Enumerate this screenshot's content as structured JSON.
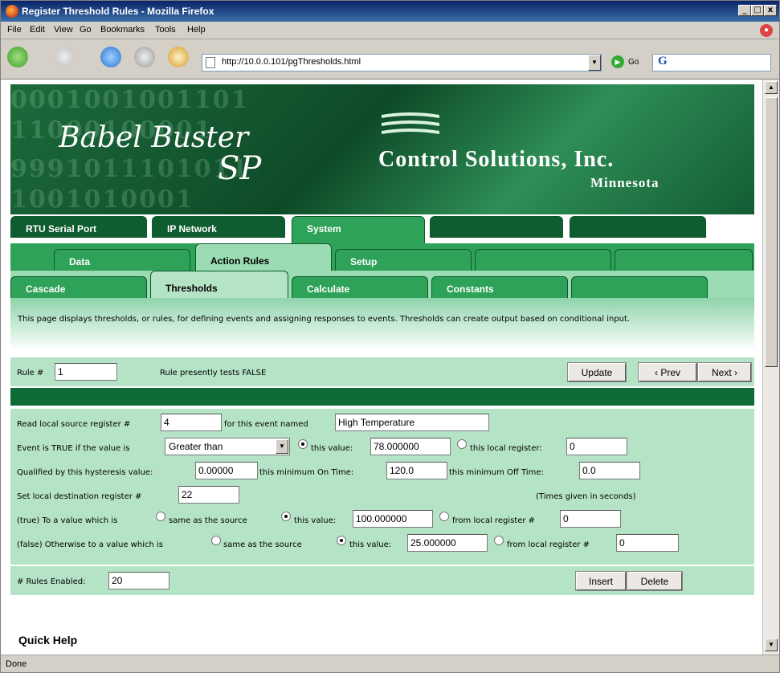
{
  "window": {
    "title": "Register Threshold Rules - Mozilla Firefox",
    "min": "_",
    "max": "□",
    "close": "x"
  },
  "menu": [
    "File",
    "Edit",
    "View",
    "Go",
    "Bookmarks",
    "Tools",
    "Help"
  ],
  "nav": {
    "url": "http://10.0.0.101/pgThresholds.html",
    "go_label": "Go",
    "search_logo": "G"
  },
  "banner": {
    "logo_line1": "Babel Buster",
    "logo_line2": "SP",
    "company": "Control Solutions, Inc.",
    "state": "Minnesota"
  },
  "tabs": {
    "row1": [
      "RTU Serial Port",
      "IP Network",
      "System",
      "",
      ""
    ],
    "row2": [
      "Data",
      "Action Rules",
      "Setup",
      "",
      ""
    ],
    "row3": [
      "Cascade",
      "Thresholds",
      "Calculate",
      "Constants",
      ""
    ]
  },
  "description": "This page displays thresholds, or rules, for defining events and assigning responses to events. Thresholds can create output based on conditional input.",
  "rule_bar": {
    "rule_label": "Rule #",
    "rule_value": "1",
    "status": "Rule presently tests FALSE",
    "update": "Update",
    "prev": "‹ Prev",
    "next": "Next ›"
  },
  "form": {
    "src_label": "Read local source register #",
    "src_value": "4",
    "event_label": "for this event named",
    "event_value": "High Temperature",
    "cond_label": "Event is TRUE if the value is",
    "cond_value": "Greater than",
    "this_value_label": "this value:",
    "this_value": "78.000000",
    "local_reg_label": "this local register:",
    "local_reg_value": "0",
    "hyst_label": "Qualified by this hysteresis value:",
    "hyst_value": "0.00000",
    "min_on_label": "this minimum On Time:",
    "min_on_value": "120.0",
    "min_off_label": "this minimum Off Time:",
    "min_off_value": "0.0",
    "dest_label": "Set local destination register #",
    "dest_value": "22",
    "times_note": "(Times given in seconds)",
    "true_label": "(true) To a value which is",
    "same_label": "same as the source",
    "true_value_label": "this value:",
    "true_value": "100.000000",
    "from_reg_label": "from local register #",
    "true_from_value": "0",
    "false_label": "(false) Otherwise to a value which is",
    "false_same_label": "same as the source",
    "false_value_label": "this value:",
    "false_value": "25.000000",
    "false_from_label": "from local register #",
    "false_from_value": "0"
  },
  "bottom": {
    "enabled_label": "# Rules Enabled:",
    "enabled_value": "20",
    "insert": "Insert",
    "delete": "Delete"
  },
  "quick_help": "Quick Help",
  "status": "Done",
  "colors": {
    "dark_green": "#0e5c2f",
    "mid_green": "#2ea258",
    "panel": "#b5e3c6"
  }
}
